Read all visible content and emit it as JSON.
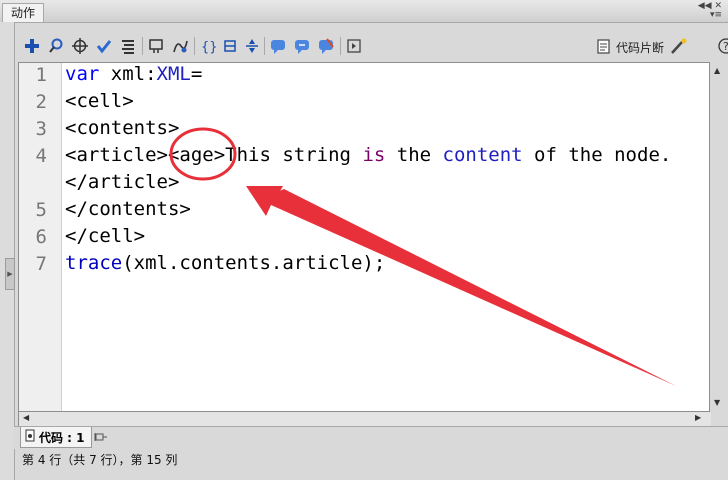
{
  "window": {
    "title": "动作"
  },
  "toolbar": {
    "icons": [
      "add-statement-icon",
      "find-icon",
      "target-icon",
      "check-syntax-icon",
      "auto-format-icon",
      "code-hint-icon",
      "debug-options-icon",
      "collapse-between-braces-icon",
      "collapse-selection-icon",
      "expand-all-icon",
      "apply-block-comment-icon",
      "apply-line-comment-icon",
      "remove-comment-icon",
      "show-hide-toolbox-icon"
    ],
    "snippets_label": "代码片断"
  },
  "editor": {
    "line_numbers": [
      "1",
      "2",
      "3",
      "4",
      "",
      "5",
      "6",
      "7"
    ],
    "lines": {
      "l1_var": "var",
      "l1_rest": " xml:",
      "l1_type": "XML",
      "l1_eq": "=",
      "l2": "<cell>",
      "l3": "<contents>",
      "l4_article": "<article>",
      "l4_age": "<age>",
      "l4_this_string": "This string ",
      "l4_is": "is",
      "l4_the": " the ",
      "l4_content": "content",
      "l4_of_the_node": " of the node.",
      "l5": "</article>",
      "l6": "</contents>",
      "l7": "</cell>",
      "l8_trace": "trace",
      "l8_rest": "(xml.contents.article);"
    }
  },
  "bottom_tab": {
    "label": "代码 : 1"
  },
  "status": {
    "text": "第 4 行（共 7 行），第 15 列"
  },
  "colors": {
    "keyword": "#0000ff",
    "annotation": "#e8303a"
  }
}
